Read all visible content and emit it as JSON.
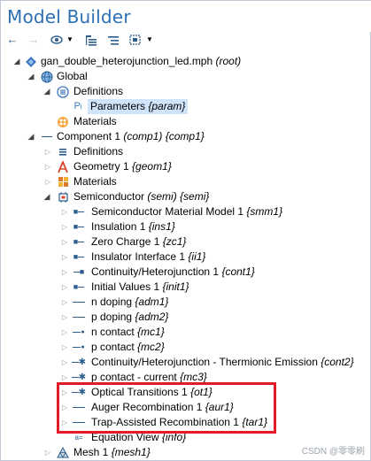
{
  "window": {
    "title": "Model Builder"
  },
  "toolbar": {
    "icons": [
      "back-arrow-icon",
      "forward-arrow-icon",
      "show-icon",
      "show-dropdown-icon",
      "expand-all-icon",
      "collapse-all-icon",
      "tree-options-icon",
      "tree-options-dropdown-icon"
    ]
  },
  "tree": {
    "root": {
      "name": "gan_double_heterojunction_led.mph",
      "tag": "(root)"
    },
    "global": {
      "name": "Global"
    },
    "definitions_global": {
      "name": "Definitions"
    },
    "parameters": {
      "name": "Parameters",
      "tag": "{param}"
    },
    "materials_global": {
      "name": "Materials"
    },
    "component": {
      "name": "Component 1",
      "tag": "(comp1) {comp1}"
    },
    "definitions_comp": {
      "name": "Definitions"
    },
    "geometry": {
      "name": "Geometry 1",
      "tag": "{geom1}"
    },
    "materials_comp": {
      "name": "Materials"
    },
    "semiconductor": {
      "name": "Semiconductor",
      "tag": "(semi) {semi}"
    },
    "semi_children": [
      {
        "name": "Semiconductor Material Model 1",
        "tag": "{smm1}"
      },
      {
        "name": "Insulation 1",
        "tag": "{ins1}"
      },
      {
        "name": "Zero Charge 1",
        "tag": "{zc1}"
      },
      {
        "name": "Insulator Interface 1",
        "tag": "{ii1}"
      },
      {
        "name": "Continuity/Heterojunction 1",
        "tag": "{cont1}"
      },
      {
        "name": "Initial Values 1",
        "tag": "{init1}"
      },
      {
        "name": "n doping",
        "tag": "{adm1}"
      },
      {
        "name": "p doping",
        "tag": "{adm2}"
      },
      {
        "name": "n contact",
        "tag": "{mc1}"
      },
      {
        "name": "p contact",
        "tag": "{mc2}"
      },
      {
        "name": "Continuity/Heterojunction - Thermionic Emission",
        "tag": "{cont2}"
      },
      {
        "name": "p contact - current",
        "tag": "{mc3}"
      },
      {
        "name": "Optical Transitions 1",
        "tag": "{ot1}"
      },
      {
        "name": "Auger Recombination 1",
        "tag": "{aur1}"
      },
      {
        "name": "Trap-Assisted Recombination 1",
        "tag": "{tar1}"
      },
      {
        "name": "Equation View",
        "tag": "{info}"
      }
    ],
    "mesh": {
      "name": "Mesh 1",
      "tag": "{mesh1}"
    }
  },
  "watermark": "CSDN @零零刷",
  "colors": {
    "title": "#2c6fb3",
    "selection": "#cfe3fb",
    "highlight": "#e21c26"
  }
}
